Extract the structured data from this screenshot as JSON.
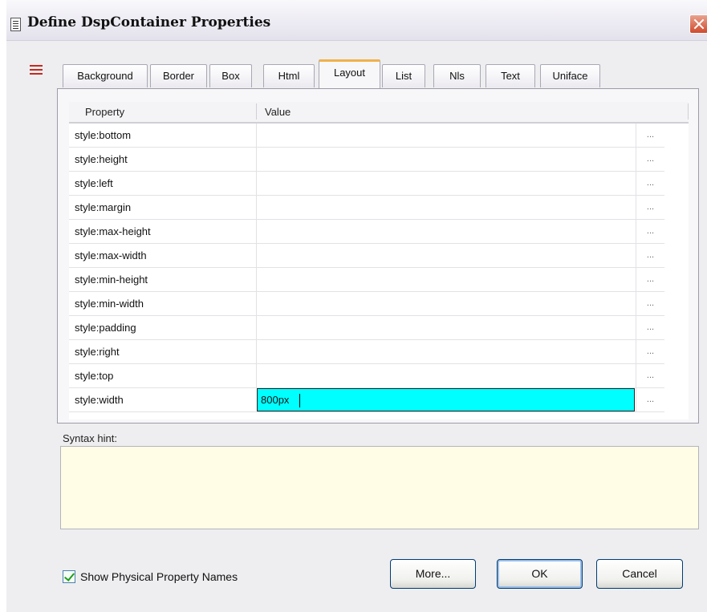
{
  "window": {
    "title": "Define DspContainer Properties"
  },
  "tabs": [
    {
      "label": "Background",
      "active": false
    },
    {
      "label": "Border",
      "active": false
    },
    {
      "label": "Box",
      "active": false
    },
    {
      "label": "Html",
      "active": false
    },
    {
      "label": "Layout",
      "active": true
    },
    {
      "label": "List",
      "active": false
    },
    {
      "label": "Nls",
      "active": false
    },
    {
      "label": "Text",
      "active": false
    },
    {
      "label": "Uniface",
      "active": false
    }
  ],
  "grid": {
    "columns": [
      "Property",
      "Value"
    ],
    "ellipsis": "...",
    "rows": [
      {
        "property": "style:bottom",
        "value": ""
      },
      {
        "property": "style:height",
        "value": ""
      },
      {
        "property": "style:left",
        "value": ""
      },
      {
        "property": "style:margin",
        "value": ""
      },
      {
        "property": "style:max-height",
        "value": ""
      },
      {
        "property": "style:max-width",
        "value": ""
      },
      {
        "property": "style:min-height",
        "value": ""
      },
      {
        "property": "style:min-width",
        "value": ""
      },
      {
        "property": "style:padding",
        "value": ""
      },
      {
        "property": "style:right",
        "value": ""
      },
      {
        "property": "style:top",
        "value": ""
      },
      {
        "property": "style:width",
        "value": "800px"
      }
    ],
    "selected_row_index": 11,
    "selected_color": "#00ffff"
  },
  "syntax_hint": {
    "label": "Syntax hint:",
    "text": ""
  },
  "footer": {
    "checkbox_label": "Show Physical Property Names",
    "checkbox_checked": true,
    "more_label": "More...",
    "ok_label": "OK",
    "cancel_label": "Cancel"
  },
  "icons": [
    "document-icon",
    "close-icon",
    "layout-icon",
    "checkbox-check-icon"
  ]
}
